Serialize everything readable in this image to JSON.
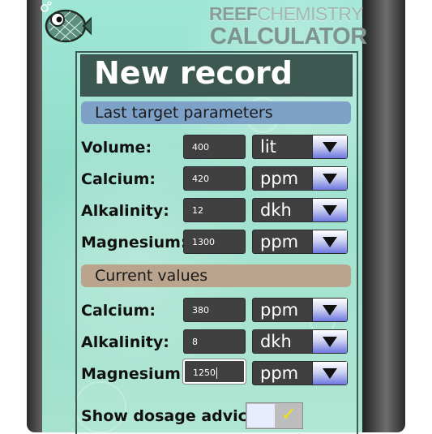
{
  "header": {
    "brand_word1": "REEF",
    "brand_word2": "CHEMISTRY",
    "brand_line2": "CALCULATOR",
    "logo_icon": "fish-logo-icon"
  },
  "title": "New record",
  "target_section": {
    "heading": "Last target parameters",
    "rows": [
      {
        "label": "Volume:",
        "value": "400",
        "unit": "lit"
      },
      {
        "label": "Calcium:",
        "value": "420",
        "unit": "ppm"
      },
      {
        "label": "Alkalinity:",
        "value": "12",
        "unit": "dkh"
      },
      {
        "label": "Magnesium:",
        "value": "1300",
        "unit": "ppm"
      }
    ]
  },
  "current_section": {
    "heading": "Current values",
    "rows": [
      {
        "label": "Calcium:",
        "value": "380",
        "unit": "ppm"
      },
      {
        "label": "Alkalinity:",
        "value": "8",
        "unit": "dkh"
      },
      {
        "label": "Magnesium:",
        "value": "1250",
        "unit": "ppm"
      }
    ]
  },
  "advice": {
    "label": "Show dosage advice?",
    "checked": true,
    "check_icon": "checkmark-icon"
  },
  "colors": {
    "screen_bg": "#9fe6d6",
    "title_bar": "#3d5850",
    "section_target": "#7ea1c8",
    "section_current": "#bba48d",
    "field_bg": "#404040",
    "check": "#f5e400"
  }
}
